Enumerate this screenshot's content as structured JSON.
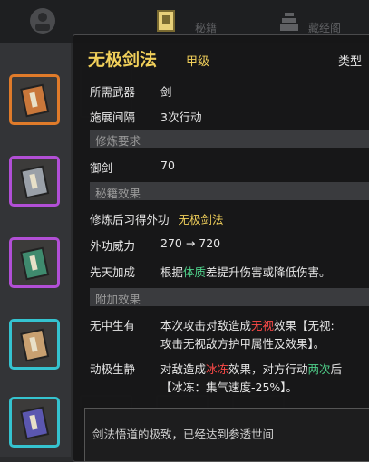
{
  "top_tabs": [
    {
      "label": "",
      "icon": "character-icon"
    },
    {
      "label": "秘籍",
      "icon": "book-tab-icon"
    },
    {
      "label": "藏经阁",
      "icon": "pagoda-icon"
    }
  ],
  "tooltip": {
    "title": "无极剑法",
    "grade": "甲级",
    "type_label": "类型",
    "weapon_label": "所需武器",
    "weapon_value": "剑",
    "interval_label": "施展间隔",
    "interval_value": "3次行动",
    "req_header": "修炼要求",
    "req_label": "御剑",
    "req_value": "70",
    "effects_header": "秘籍效果",
    "effect_prefix": "修炼后习得外功",
    "effect_skill": "无极剑法",
    "power_label": "外功威力",
    "power_value": "270 → 720",
    "innate_label": "先天加成",
    "innate_pre": "根据",
    "innate_keyword": "体质",
    "innate_post": "差提升伤害或降低伤害。",
    "extra_header": "附加效果",
    "extra1_name": "无中生有",
    "extra1_pre": "本次攻击对敌造成",
    "extra1_effect": "无视",
    "extra1_post": "效果【无视:",
    "extra1_line2": "攻击无视敌方护甲属性及效果】。",
    "extra2_name": "动极生静",
    "extra2_pre": "对敌造成",
    "extra2_effect": "冰冻",
    "extra2_mid": "效果，对方行动",
    "extra2_highlight": "两次",
    "extra2_tail": "后",
    "extra2_line2": "【冰冻：集气速度-25%】。",
    "quote": "剑法悟道的极致，已经达到参透世间"
  },
  "book_slots": [
    {
      "border": "#e07b2a",
      "cover": "#c9773a"
    },
    {
      "border": "#b24fd6",
      "cover": "#9aa0a8"
    },
    {
      "border": "#b24fd6",
      "cover": "#3f8a6e"
    },
    {
      "border": "#35c3cf",
      "cover": "#c8a070"
    },
    {
      "border": "#35c3cf",
      "cover": "#5b57b0"
    }
  ],
  "colors": {
    "gold": "#f0cf5a",
    "green": "#4fd08a",
    "red": "#ff4a48"
  }
}
